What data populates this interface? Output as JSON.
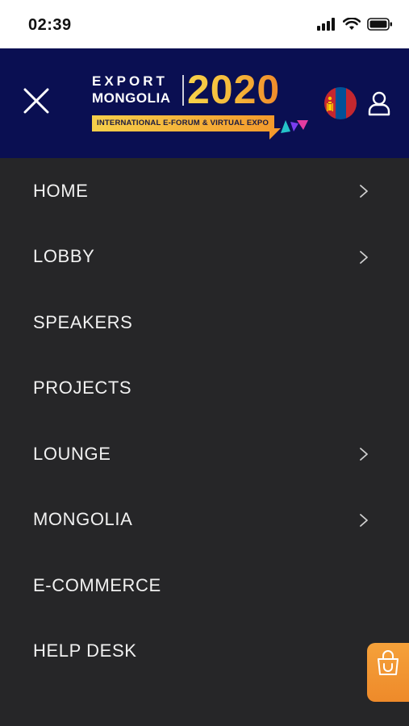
{
  "status": {
    "time": "02:39"
  },
  "header": {
    "logo": {
      "line1": "EXPORT",
      "line2": "MONGOLIA",
      "year": "2020",
      "banner": "INTERNATIONAL E-FORUM & VIRTUAL EXPO"
    },
    "icons": {
      "close": "close-icon",
      "flag": "mongolia-flag-icon",
      "user": "user-icon"
    }
  },
  "menu": {
    "items": [
      {
        "label": "HOME",
        "has_chevron": true
      },
      {
        "label": "LOBBY",
        "has_chevron": true
      },
      {
        "label": "SPEAKERS",
        "has_chevron": false
      },
      {
        "label": "PROJECTS",
        "has_chevron": false
      },
      {
        "label": "LOUNGE",
        "has_chevron": true
      },
      {
        "label": "MONGOLIA",
        "has_chevron": true
      },
      {
        "label": "E-COMMERCE",
        "has_chevron": false
      },
      {
        "label": "HELP DESK",
        "has_chevron": false
      }
    ]
  },
  "colors": {
    "header_bg": "#0a0f52",
    "menu_bg": "#262628",
    "accent": "#f39a2c",
    "text": "#f1f1f1"
  },
  "floating": {
    "icon": "shopping-bag-icon"
  }
}
